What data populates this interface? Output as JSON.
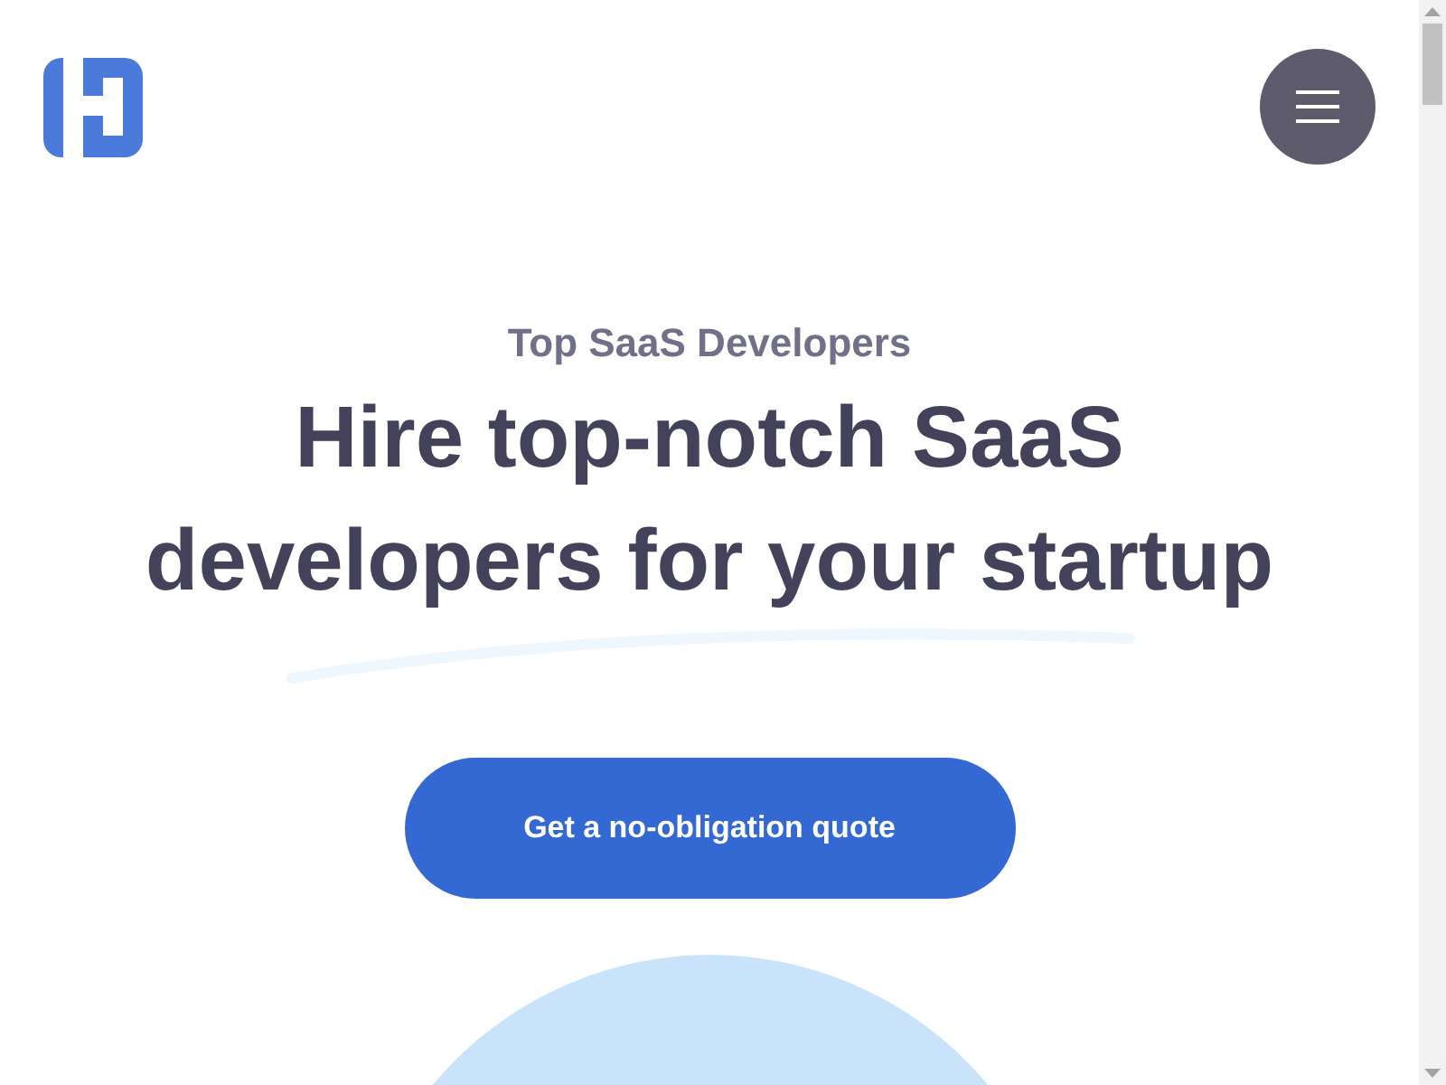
{
  "hero": {
    "eyebrow": "Top SaaS Developers",
    "headline": "Hire top-notch SaaS developers for your startup",
    "cta": "Get a no-obligation quote"
  }
}
